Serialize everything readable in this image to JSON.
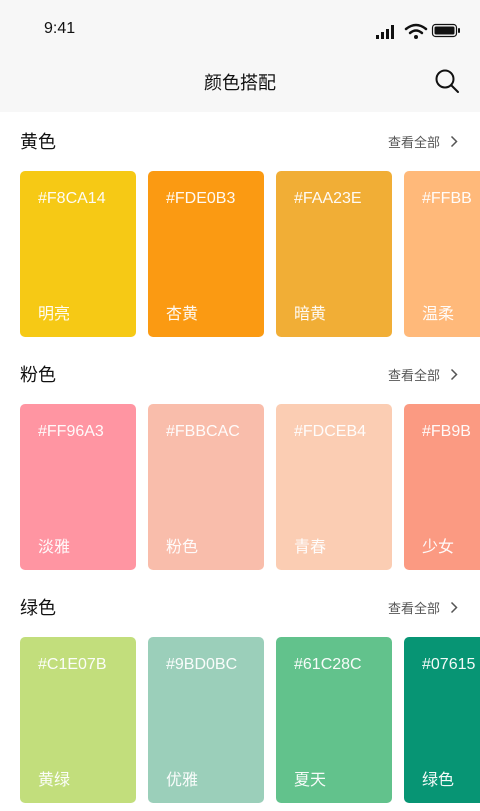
{
  "status": {
    "time": "9:41"
  },
  "nav": {
    "title": "颜色搭配"
  },
  "sections": [
    {
      "title": "黄色",
      "view_all": "查看全部",
      "cards": [
        {
          "hex": "#F8CA14",
          "name": "明亮",
          "color": "#F6C915"
        },
        {
          "hex": "#FDE0B3",
          "name": "杏黄",
          "color": "#FB9A12"
        },
        {
          "hex": "#FAA23E",
          "name": "暗黄",
          "color": "#F1AE36"
        },
        {
          "hex": "#FFBB",
          "name": "温柔",
          "color": "#FFB97A"
        }
      ]
    },
    {
      "title": "粉色",
      "view_all": "查看全部",
      "cards": [
        {
          "hex": "#FF96A3",
          "name": "淡雅",
          "color": "#FF95A2"
        },
        {
          "hex": "#FBBCAC",
          "name": "粉色",
          "color": "#F9BDAB"
        },
        {
          "hex": "#FDCEB4",
          "name": "青春",
          "color": "#FBCDB3"
        },
        {
          "hex": "#FB9B",
          "name": "少女",
          "color": "#FB9A82"
        }
      ]
    },
    {
      "title": "绿色",
      "view_all": "查看全部",
      "cards": [
        {
          "hex": "#C1E07B",
          "name": "黄绿",
          "color": "#C2DE7C"
        },
        {
          "hex": "#9BD0BC",
          "name": "优雅",
          "color": "#9BCFBA"
        },
        {
          "hex": "#61C28C",
          "name": "夏天",
          "color": "#62C28C"
        },
        {
          "hex": "#07615",
          "name": "绿色",
          "color": "#079574"
        }
      ]
    }
  ]
}
